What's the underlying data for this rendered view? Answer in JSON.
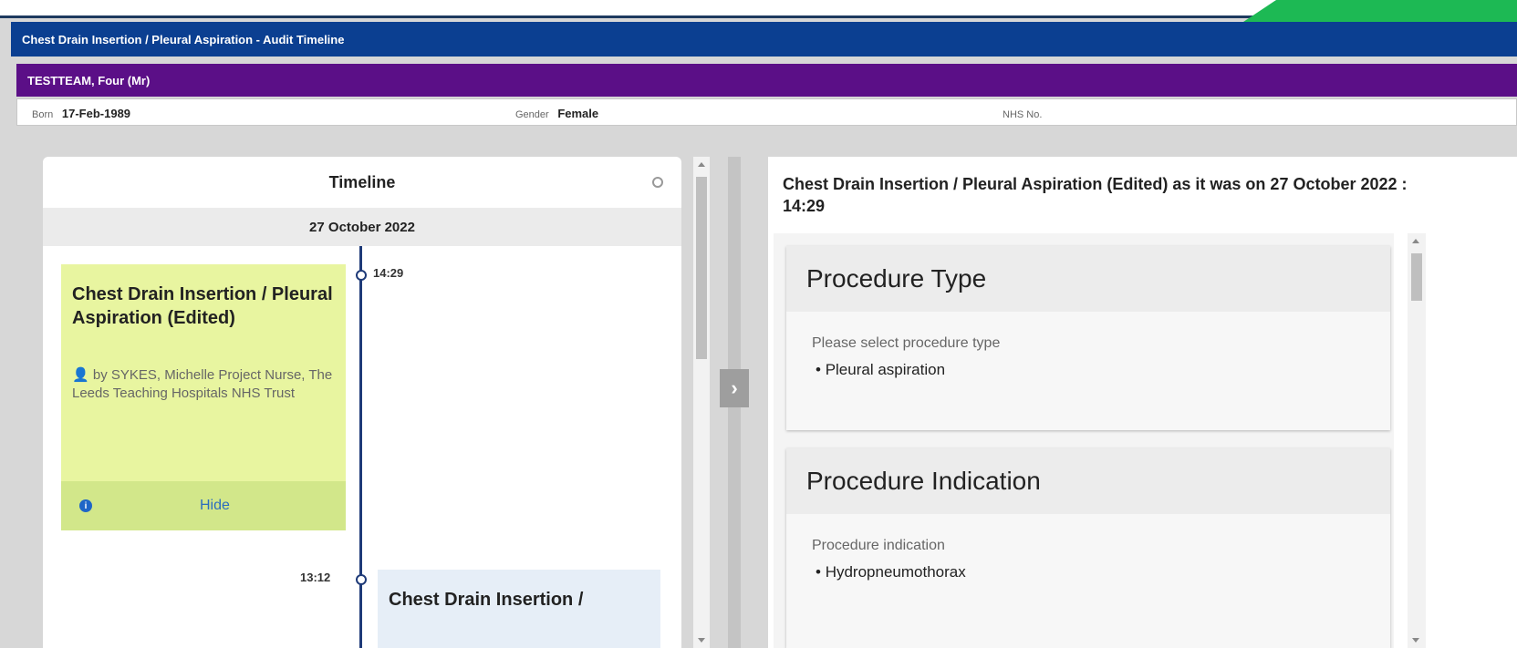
{
  "window": {
    "title": "Chest Drain Insertion / Pleural Aspiration - Audit Timeline"
  },
  "patient": {
    "name": "TESTTEAM, Four (Mr)",
    "born_label": "Born",
    "born_value": "17-Feb-1989",
    "gender_label": "Gender",
    "gender_value": "Female",
    "nhs_label": "NHS No.",
    "nhs_value": ""
  },
  "timeline": {
    "title": "Timeline",
    "date": "27 October 2022",
    "entries": [
      {
        "time": "14:29",
        "title": "Chest Drain Insertion / Pleural Aspiration (Edited)",
        "author": "by SYKES, Michelle Project Nurse, The Leeds Teaching Hospitals NHS Trust",
        "hide_label": "Hide"
      },
      {
        "time": "13:12",
        "title": "Chest Drain Insertion /"
      }
    ]
  },
  "detail": {
    "title": "Chest Drain Insertion / Pleural Aspiration (Edited) as it was on 27 October 2022 : 14:29",
    "sections": [
      {
        "heading": "Procedure Type",
        "label": "Please select procedure type",
        "value": "Pleural aspiration"
      },
      {
        "heading": "Procedure Indication",
        "label": "Procedure indication",
        "value": "Hydropneumothorax"
      }
    ]
  },
  "colors": {
    "title_bar": "#0b3f91",
    "patient_bar": "#5b0f87",
    "edited_card": "#e8f5a0",
    "accent_green": "#1db954"
  }
}
